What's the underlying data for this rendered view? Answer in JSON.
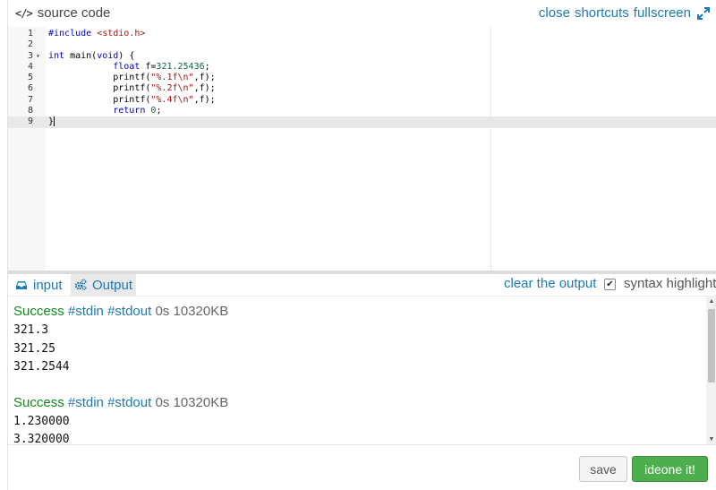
{
  "header": {
    "title": "source code",
    "links": [
      "close",
      "shortcuts",
      "fullscreen"
    ]
  },
  "editor": {
    "lines": [
      {
        "n": "1",
        "fold": "",
        "code": "#include <stdio.h>"
      },
      {
        "n": "2",
        "fold": "",
        "code": ""
      },
      {
        "n": "3",
        "fold": "▾",
        "code": "int main(void) {"
      },
      {
        "n": "4",
        "fold": "",
        "code": "            float f=321.25436;"
      },
      {
        "n": "5",
        "fold": "",
        "code": "            printf(\"%.1f\\n\",f);"
      },
      {
        "n": "6",
        "fold": "",
        "code": "            printf(\"%.2f\\n\",f);"
      },
      {
        "n": "7",
        "fold": "",
        "code": "            printf(\"%.4f\\n\",f);"
      },
      {
        "n": "8",
        "fold": "",
        "code": "            return 0;"
      },
      {
        "n": "9",
        "fold": "",
        "code": "}"
      }
    ],
    "active_line": 9
  },
  "tabs": {
    "input_label": "input",
    "output_label": "Output",
    "clear_label": "clear the output",
    "syntax_label": "syntax highlight",
    "syntax_checked": true
  },
  "output": {
    "results": [
      {
        "status": "Success",
        "stdin": "#stdin",
        "stdout": "#stdout",
        "meta": "0s 10320KB",
        "lines": [
          "321.3",
          "321.25",
          "321.2544"
        ]
      },
      {
        "status": "Success",
        "stdin": "#stdin",
        "stdout": "#stdout",
        "meta": "0s 10320KB",
        "lines": [
          "1.230000",
          "3.320000"
        ]
      }
    ]
  },
  "footer": {
    "save_label": "save",
    "run_label": "ideone it!"
  },
  "colors": {
    "link": "#1a7ab5",
    "success": "#128a1f",
    "run_button": "#4cae4c"
  },
  "icons": {
    "header": "code-icon",
    "fullscreen": "expand-icon",
    "input_tab": "inbox-icon",
    "output_tab": "gears-icon"
  }
}
